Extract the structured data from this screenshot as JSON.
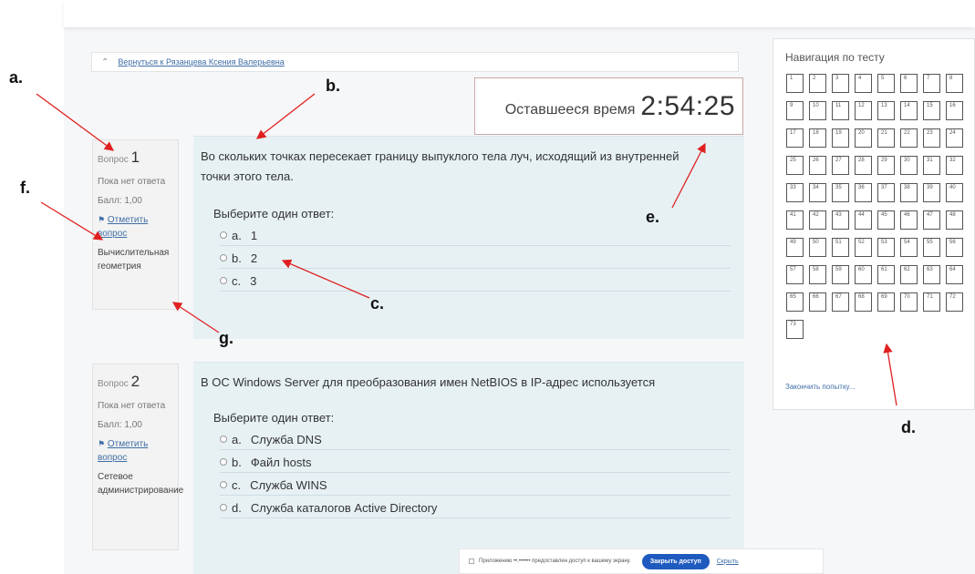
{
  "breadcrumb": {
    "link": "Вернуться к Рязанцева Ксения Валерьевна"
  },
  "timer": {
    "label": "Оставшееся время",
    "value": "2:54:25"
  },
  "questions": [
    {
      "label": "Вопрос",
      "number": "1",
      "status": "Пока нет ответа",
      "score": "Балл: 1,00",
      "flag": "Отметить вопрос",
      "category": "Вычислительная геометрия",
      "text": "Во скольких точках пересекает границу выпуклого тела луч, исходящий из внутренней точки этого тела.",
      "prompt": "Выберите один ответ:",
      "options": [
        {
          "letter": "a.",
          "text": "1"
        },
        {
          "letter": "b.",
          "text": "2"
        },
        {
          "letter": "c.",
          "text": "3"
        }
      ]
    },
    {
      "label": "Вопрос",
      "number": "2",
      "status": "Пока нет ответа",
      "score": "Балл: 1,00",
      "flag": "Отметить вопрос",
      "category": "Сетевое администрирование",
      "text": "В ОС Windows Server для преобразования имен NetBIOS в IP-адрес используется",
      "prompt": "Выберите один ответ:",
      "options": [
        {
          "letter": "a.",
          "text": "Служба DNS"
        },
        {
          "letter": "b.",
          "text": "Файл hosts"
        },
        {
          "letter": "c.",
          "text": "Служба WINS"
        },
        {
          "letter": "d.",
          "text": "Служба каталогов Active Directory"
        }
      ]
    }
  ],
  "navigation": {
    "title": "Навигация по тесту",
    "buttons": [
      "1",
      "2",
      "3",
      "4",
      "5",
      "6",
      "7",
      "8",
      "9",
      "10",
      "11",
      "12",
      "13",
      "14",
      "15",
      "16",
      "17",
      "18",
      "19",
      "20",
      "21",
      "22",
      "23",
      "24",
      "25",
      "26",
      "27",
      "28",
      "29",
      "30",
      "31",
      "32",
      "33",
      "34",
      "35",
      "36",
      "37",
      "38",
      "39",
      "40",
      "41",
      "42",
      "43",
      "44",
      "45",
      "46",
      "47",
      "48",
      "49",
      "50",
      "51",
      "52",
      "53",
      "54",
      "55",
      "56",
      "57",
      "58",
      "59",
      "60",
      "61",
      "62",
      "63",
      "64",
      "65",
      "66",
      "67",
      "68",
      "69",
      "70",
      "71",
      "72",
      "73"
    ],
    "finish": "Закончить попытку..."
  },
  "footer": {
    "notice": "Приложению ••.•••••• предоставлен доступ к вашему экрану.",
    "close_button": "Закрыть доступ",
    "hide_link": "Скрыть"
  },
  "annotations": {
    "a": "a.",
    "b": "b.",
    "c": "c.",
    "d": "d.",
    "e": "e.",
    "f": "f.",
    "g": "g."
  },
  "colors": {
    "accent": "#1f5bbf",
    "link": "#3f6ea6",
    "question_bg": "#e7f1f4",
    "arrow": "#e02020"
  }
}
